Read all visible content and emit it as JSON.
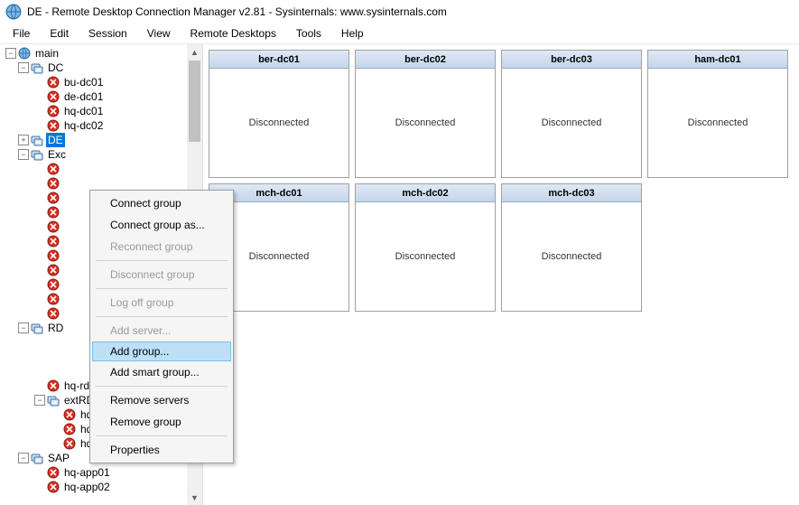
{
  "title": "DE - Remote Desktop Connection Manager v2.81 - Sysinternals: www.sysinternals.com",
  "menu": [
    "File",
    "Edit",
    "Session",
    "View",
    "Remote Desktops",
    "Tools",
    "Help"
  ],
  "tree": [
    {
      "indent": 0,
      "twisty": "-",
      "icon": "globe",
      "label": "main"
    },
    {
      "indent": 1,
      "twisty": "-",
      "icon": "group",
      "label": "DC"
    },
    {
      "indent": 2,
      "twisty": "",
      "icon": "server-off",
      "label": "bu-dc01"
    },
    {
      "indent": 2,
      "twisty": "",
      "icon": "server-off",
      "label": "de-dc01"
    },
    {
      "indent": 2,
      "twisty": "",
      "icon": "server-off",
      "label": "hq-dc01"
    },
    {
      "indent": 2,
      "twisty": "",
      "icon": "server-off",
      "label": "hq-dc02"
    },
    {
      "indent": 1,
      "twisty": "+",
      "icon": "group",
      "label": "DE",
      "selected": true
    },
    {
      "indent": 1,
      "twisty": "-",
      "icon": "group",
      "label": "Exc"
    },
    {
      "indent": 2,
      "twisty": "",
      "icon": "server-off",
      "label": ""
    },
    {
      "indent": 2,
      "twisty": "",
      "icon": "server-off",
      "label": ""
    },
    {
      "indent": 2,
      "twisty": "",
      "icon": "server-off",
      "label": ""
    },
    {
      "indent": 2,
      "twisty": "",
      "icon": "server-off",
      "label": ""
    },
    {
      "indent": 2,
      "twisty": "",
      "icon": "server-off",
      "label": ""
    },
    {
      "indent": 2,
      "twisty": "",
      "icon": "server-off",
      "label": ""
    },
    {
      "indent": 2,
      "twisty": "",
      "icon": "server-off",
      "label": ""
    },
    {
      "indent": 2,
      "twisty": "",
      "icon": "server-off",
      "label": ""
    },
    {
      "indent": 2,
      "twisty": "",
      "icon": "server-off",
      "label": ""
    },
    {
      "indent": 2,
      "twisty": "",
      "icon": "server-off",
      "label": ""
    },
    {
      "indent": 2,
      "twisty": "",
      "icon": "server-off",
      "label": ""
    },
    {
      "indent": 1,
      "twisty": "-",
      "icon": "group",
      "label": "RD"
    },
    {
      "indent": 2,
      "twisty": "",
      "icon": "none",
      "label": ""
    },
    {
      "indent": 2,
      "twisty": "",
      "icon": "none",
      "label": ""
    },
    {
      "indent": 2,
      "twisty": "",
      "icon": "none",
      "label": ""
    },
    {
      "indent": 2,
      "twisty": "",
      "icon": "server-off",
      "label": "hq-rds04"
    },
    {
      "indent": 2,
      "twisty": "-",
      "icon": "group",
      "label": "extRDS"
    },
    {
      "indent": 3,
      "twisty": "",
      "icon": "server-off",
      "label": "hq-rds-ex01"
    },
    {
      "indent": 3,
      "twisty": "",
      "icon": "server-off",
      "label": "hq-rds-ex02"
    },
    {
      "indent": 3,
      "twisty": "",
      "icon": "server-off",
      "label": "hq-rds-ex03"
    },
    {
      "indent": 1,
      "twisty": "-",
      "icon": "group",
      "label": "SAP"
    },
    {
      "indent": 2,
      "twisty": "",
      "icon": "server-off",
      "label": "hq-app01"
    },
    {
      "indent": 2,
      "twisty": "",
      "icon": "server-off",
      "label": "hq-app02"
    }
  ],
  "thumbnails": [
    {
      "name": "ber-dc01",
      "status": "Disconnected"
    },
    {
      "name": "ber-dc02",
      "status": "Disconnected"
    },
    {
      "name": "ber-dc03",
      "status": "Disconnected"
    },
    {
      "name": "ham-dc01",
      "status": "Disconnected"
    },
    {
      "name": "mch-dc01",
      "status": "Disconnected"
    },
    {
      "name": "mch-dc02",
      "status": "Disconnected"
    },
    {
      "name": "mch-dc03",
      "status": "Disconnected"
    }
  ],
  "context_menu": [
    {
      "label": "Connect group",
      "disabled": false
    },
    {
      "label": "Connect group as...",
      "disabled": false
    },
    {
      "label": "Reconnect group",
      "disabled": true
    },
    {
      "sep": true
    },
    {
      "label": "Disconnect group",
      "disabled": true
    },
    {
      "sep": true
    },
    {
      "label": "Log off group",
      "disabled": true
    },
    {
      "sep": true
    },
    {
      "label": "Add server...",
      "disabled": true
    },
    {
      "label": "Add group...",
      "disabled": false,
      "highlight": true
    },
    {
      "label": "Add smart group...",
      "disabled": false
    },
    {
      "sep": true
    },
    {
      "label": "Remove servers",
      "disabled": false
    },
    {
      "label": "Remove group",
      "disabled": false
    },
    {
      "sep": true
    },
    {
      "label": "Properties",
      "disabled": false
    }
  ]
}
